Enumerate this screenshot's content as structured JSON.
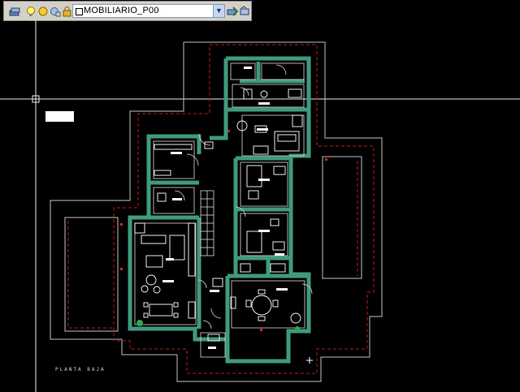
{
  "toolbar": {
    "layer_name": "MOBILIARIO_P00",
    "icons": [
      "layer-manager-icon",
      "bulb-on-icon",
      "sun-freeze-icon",
      "lock-icon",
      "color-swatch-icon",
      "dropdown-arrow-icon",
      "layer-previous-icon",
      "make-current-icon"
    ]
  },
  "drawing": {
    "plan_label": "PLANTA BAJA",
    "colors": {
      "background": "#000000",
      "walls": "#3f9a7e",
      "lines": "#d8d8d8",
      "dashed_boundary": "#c01818",
      "crosshair": "#e8e8e8",
      "furniture": "#ffffff"
    }
  }
}
